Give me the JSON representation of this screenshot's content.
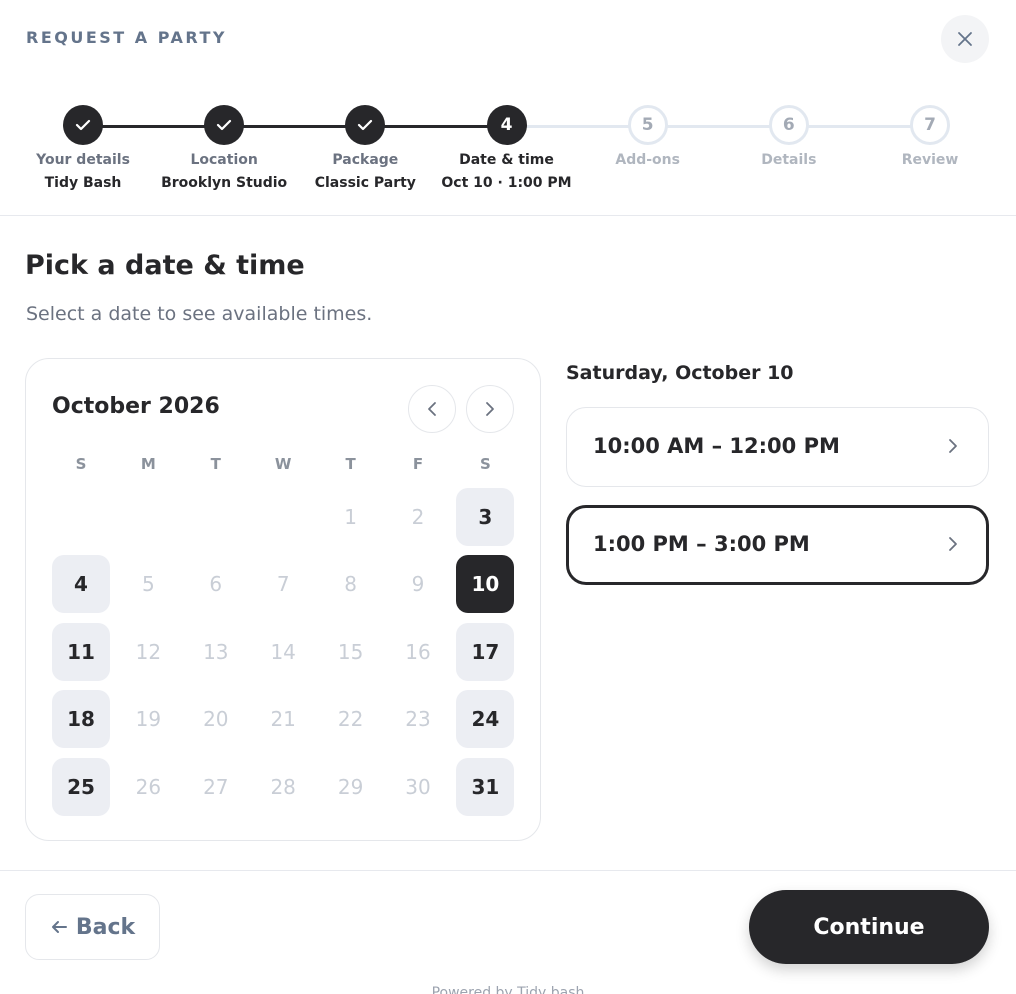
{
  "header": {
    "title": "REQUEST A PARTY",
    "close_icon": "close-icon"
  },
  "stepper": {
    "steps": [
      {
        "number": "1",
        "label": "Your details",
        "value": "Tidy Bash",
        "state": "done"
      },
      {
        "number": "2",
        "label": "Location",
        "value": "Brooklyn Studio",
        "state": "done"
      },
      {
        "number": "3",
        "label": "Package",
        "value": "Classic Party",
        "state": "done"
      },
      {
        "number": "4",
        "label": "Date & time",
        "value": "Oct 10 · 1:00 PM",
        "state": "active"
      },
      {
        "number": "5",
        "label": "Add-ons",
        "value": "",
        "state": "todo"
      },
      {
        "number": "6",
        "label": "Details",
        "value": "",
        "state": "todo"
      },
      {
        "number": "7",
        "label": "Review",
        "value": "",
        "state": "todo"
      }
    ]
  },
  "main": {
    "title": "Pick a date & time",
    "subtitle": "Select a date to see available times."
  },
  "calendar": {
    "month_label": "October 2026",
    "prev_icon": "chevron-left-icon",
    "next_icon": "chevron-right-icon",
    "weekdays": [
      "S",
      "M",
      "T",
      "W",
      "T",
      "F",
      "S"
    ],
    "first_weekday_index": 4,
    "days_in_month": 31,
    "available_days": [
      3,
      4,
      10,
      11,
      17,
      18,
      24,
      25,
      31
    ],
    "selected_day": 10
  },
  "slots": {
    "date_label": "Saturday, October 10",
    "items": [
      {
        "label": "10:00 AM – 12:00 PM",
        "selected": false
      },
      {
        "label": "1:00 PM – 3:00 PM",
        "selected": true
      }
    ]
  },
  "footer": {
    "back_label": "Back",
    "continue_label": "Continue",
    "powered_by": "Powered by Tidy bash"
  },
  "colors": {
    "primary": "#27272a",
    "muted": "#64748b",
    "available_bg": "#eceef3",
    "disabled_text": "#c9ced6"
  }
}
